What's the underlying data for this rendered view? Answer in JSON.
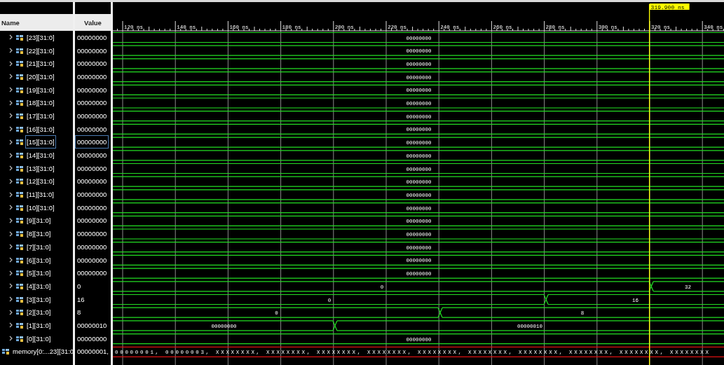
{
  "columns": {
    "name": "Name",
    "value": "Value"
  },
  "ruler": {
    "ticks": [
      "120 ns",
      "140 ns",
      "160 ns",
      "180 ns",
      "200 ns",
      "220 ns",
      "240 ns",
      "260 ns",
      "280 ns",
      "300 ns",
      "320 ns",
      "340 ns"
    ]
  },
  "cursor": {
    "label": "319.900 ns"
  },
  "rows": [
    {
      "kind": "bus",
      "name": "[23][31:0]",
      "value": "00000000",
      "selected": false,
      "segments": [
        {
          "value": "00000000"
        }
      ]
    },
    {
      "kind": "bus",
      "name": "[22][31:0]",
      "value": "00000000",
      "selected": false,
      "segments": [
        {
          "value": "00000000"
        }
      ]
    },
    {
      "kind": "bus",
      "name": "[21][31:0]",
      "value": "00000000",
      "selected": false,
      "segments": [
        {
          "value": "00000000"
        }
      ]
    },
    {
      "kind": "bus",
      "name": "[20][31:0]",
      "value": "00000000",
      "selected": false,
      "segments": [
        {
          "value": "00000000"
        }
      ]
    },
    {
      "kind": "bus",
      "name": "[19][31:0]",
      "value": "00000000",
      "selected": false,
      "segments": [
        {
          "value": "00000000"
        }
      ]
    },
    {
      "kind": "bus",
      "name": "[18][31:0]",
      "value": "00000000",
      "selected": false,
      "segments": [
        {
          "value": "00000000"
        }
      ]
    },
    {
      "kind": "bus",
      "name": "[17][31:0]",
      "value": "00000000",
      "selected": false,
      "segments": [
        {
          "value": "00000000"
        }
      ]
    },
    {
      "kind": "bus",
      "name": "[16][31:0]",
      "value": "00000000",
      "selected": false,
      "segments": [
        {
          "value": "00000000"
        }
      ]
    },
    {
      "kind": "bus",
      "name": "[15][31:0]",
      "value": "00000000",
      "selected": true,
      "segments": [
        {
          "value": "00000000"
        }
      ]
    },
    {
      "kind": "bus",
      "name": "[14][31:0]",
      "value": "00000000",
      "selected": false,
      "segments": [
        {
          "value": "00000000"
        }
      ]
    },
    {
      "kind": "bus",
      "name": "[13][31:0]",
      "value": "00000000",
      "selected": false,
      "segments": [
        {
          "value": "00000000"
        }
      ]
    },
    {
      "kind": "bus",
      "name": "[12][31:0]",
      "value": "00000000",
      "selected": false,
      "segments": [
        {
          "value": "00000000"
        }
      ]
    },
    {
      "kind": "bus",
      "name": "[11][31:0]",
      "value": "00000000",
      "selected": false,
      "segments": [
        {
          "value": "00000000"
        }
      ]
    },
    {
      "kind": "bus",
      "name": "[10][31:0]",
      "value": "00000000",
      "selected": false,
      "segments": [
        {
          "value": "00000000"
        }
      ]
    },
    {
      "kind": "bus",
      "name": "[9][31:0]",
      "value": "00000000",
      "selected": false,
      "segments": [
        {
          "value": "00000000"
        }
      ]
    },
    {
      "kind": "bus",
      "name": "[8][31:0]",
      "value": "00000000",
      "selected": false,
      "segments": [
        {
          "value": "00000000"
        }
      ]
    },
    {
      "kind": "bus",
      "name": "[7][31:0]",
      "value": "00000000",
      "selected": false,
      "segments": [
        {
          "value": "00000000"
        }
      ]
    },
    {
      "kind": "bus",
      "name": "[6][31:0]",
      "value": "00000000",
      "selected": false,
      "segments": [
        {
          "value": "00000000"
        }
      ]
    },
    {
      "kind": "bus",
      "name": "[5][31:0]",
      "value": "00000000",
      "selected": false,
      "segments": [
        {
          "value": "00000000"
        }
      ]
    },
    {
      "kind": "bus",
      "name": "[4][31:0]",
      "value": "0",
      "selected": false,
      "segments": [
        {
          "value": "0",
          "level": 0.88
        },
        {
          "value": "32"
        }
      ]
    },
    {
      "kind": "bus",
      "name": "[3][31:0]",
      "value": "16",
      "selected": false,
      "segments": [
        {
          "value": "0",
          "level": 0.708
        },
        {
          "value": "16"
        }
      ]
    },
    {
      "kind": "bus",
      "name": "[2][31:0]",
      "value": "8",
      "selected": false,
      "segments": [
        {
          "value": "0",
          "level": 0.535
        },
        {
          "value": "8"
        }
      ]
    },
    {
      "kind": "bus",
      "name": "[1][31:0]",
      "value": "00000010",
      "selected": false,
      "segments": [
        {
          "value": "00000000",
          "level": 0.363
        },
        {
          "value": "00000010"
        }
      ]
    },
    {
      "kind": "bus",
      "name": "[0][31:0]",
      "value": "00000000",
      "selected": false,
      "segments": [
        {
          "value": "00000000"
        }
      ]
    },
    {
      "kind": "array",
      "name": "memory[0:...23][31:0",
      "value": "00000001,",
      "selected": false,
      "segments": [
        {
          "value": "00000001, 00000003, XXXXXXXX, XXXXXXXX, XXXXXXXX, XXXXXXXX, XXXXXXXX, XXXXXXXX, XXXXXXXX, XXXXXXXX, XXXXXXXX, XXXXXXXX"
        }
      ]
    }
  ]
}
